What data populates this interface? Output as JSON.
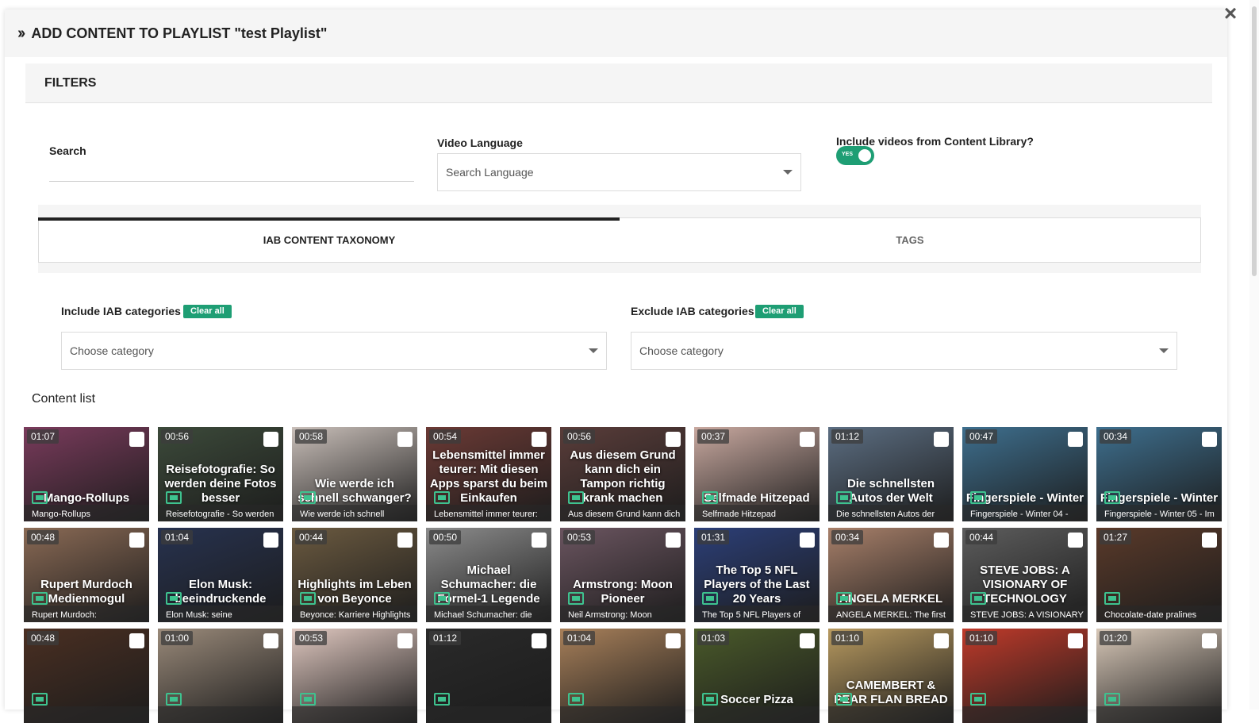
{
  "modal": {
    "title": "ADD CONTENT TO PLAYLIST \"test Playlist\"",
    "close_icon": "close-icon"
  },
  "filters": {
    "heading": "FILTERS",
    "search_label": "Search",
    "search_value": "",
    "language_label": "Video Language",
    "language_placeholder": "Search Language",
    "library_label": "Include videos from Content Library?",
    "library_toggle_text": "YES",
    "library_toggle_on": true
  },
  "tabs": [
    {
      "label": "IAB CONTENT TAXONOMY",
      "active": true
    },
    {
      "label": "TAGS",
      "active": false
    }
  ],
  "iab": {
    "include_label": "Include IAB categories",
    "exclude_label": "Exclude IAB categories",
    "clear_all": "Clear all",
    "include_placeholder": "Choose category",
    "exclude_placeholder": "Choose category"
  },
  "content": {
    "title": "Content list",
    "items": [
      {
        "duration": "01:07",
        "name": "Mango-Rollups",
        "caption": "Mango-Rollups",
        "color": "#7a3b5c"
      },
      {
        "duration": "00:56",
        "name": "Reisefotografie - So werden",
        "caption": "Reisefotografie: So werden deine Fotos besser",
        "color": "#3c4a3a"
      },
      {
        "duration": "00:58",
        "name": "Wie werde ich schnell",
        "caption": "Wie werde ich schnell schwanger?",
        "color": "#c9bfb9"
      },
      {
        "duration": "00:54",
        "name": "Lebensmittel immer teurer:",
        "caption": "Lebensmittel immer teurer: Mit diesen Apps sparst du beim Einkaufen",
        "color": "#6b3a35"
      },
      {
        "duration": "00:56",
        "name": "Aus diesem Grund kann dich",
        "caption": "Aus diesem Grund kann dich ein Tampon richtig krank machen",
        "color": "#5a3d3a"
      },
      {
        "duration": "00:37",
        "name": "Selfmade Hitzepad",
        "caption": "Selfmade Hitzepad",
        "color": "#c9a9a0"
      },
      {
        "duration": "01:12",
        "name": "Die schnellsten Autos der",
        "caption": "Die schnellsten Autos der Welt",
        "color": "#5c6e82"
      },
      {
        "duration": "00:47",
        "name": "Fingerspiele - Winter 04 -",
        "caption": "Fingerspiele - Winter",
        "color": "#3e6f8e"
      },
      {
        "duration": "00:34",
        "name": "Fingerspiele - Winter 05 - Im",
        "caption": "Fingerspiele - Winter",
        "color": "#3e6f8e"
      },
      {
        "duration": "00:48",
        "name": "Rupert Murdoch:",
        "caption": "Rupert Murdoch Medienmogul",
        "color": "#8a6a55"
      },
      {
        "duration": "01:04",
        "name": "Elon Musk: seine",
        "caption": "Elon Musk: beeindruckende",
        "color": "#27324f"
      },
      {
        "duration": "00:44",
        "name": "Beyonce: Karriere Highlights",
        "caption": "Highlights im Leben von Beyonce",
        "color": "#6b5a40"
      },
      {
        "duration": "00:50",
        "name": "Michael Schumacher: die",
        "caption": "Michael Schumacher: die Formel-1 Legende",
        "color": "#8c8c8c"
      },
      {
        "duration": "00:53",
        "name": "Neil Armstrong: Moon",
        "caption": "Armstrong: Moon Pioneer",
        "color": "#6b5560"
      },
      {
        "duration": "01:31",
        "name": "The Top 5 NFL Players of",
        "caption": "The Top 5 NFL Players of the Last 20 Years",
        "color": "#2c3f78"
      },
      {
        "duration": "00:34",
        "name": "ANGELA MERKEL: The first",
        "caption": "ANGELA MERKEL",
        "color": "#a8806a"
      },
      {
        "duration": "00:44",
        "name": "STEVE JOBS: A VISIONARY",
        "caption": "STEVE JOBS: A VISIONARY OF TECHNOLOGY",
        "color": "#5d5d5d"
      },
      {
        "duration": "01:27",
        "name": "Chocolate-date pralines",
        "caption": "",
        "color": "#5a3a2a"
      },
      {
        "duration": "00:48",
        "name": "",
        "caption": "",
        "color": "#4a2f22"
      },
      {
        "duration": "01:00",
        "name": "",
        "caption": "",
        "color": "#9a8a7a"
      },
      {
        "duration": "00:53",
        "name": "",
        "caption": "",
        "color": "#e0c8c0"
      },
      {
        "duration": "01:12",
        "name": "",
        "caption": "",
        "color": "#2a2a2a"
      },
      {
        "duration": "01:04",
        "name": "",
        "caption": "",
        "color": "#a8805a"
      },
      {
        "duration": "01:03",
        "name": "",
        "caption": "Soccer Pizza",
        "color": "#4a5a2a"
      },
      {
        "duration": "01:10",
        "name": "",
        "caption": "CAMEMBERT & PEAR FLAN BREAD",
        "color": "#b89a60"
      },
      {
        "duration": "01:10",
        "name": "",
        "caption": "",
        "color": "#c03a2a"
      },
      {
        "duration": "01:20",
        "name": "",
        "caption": "",
        "color": "#d8c8b8"
      }
    ]
  }
}
